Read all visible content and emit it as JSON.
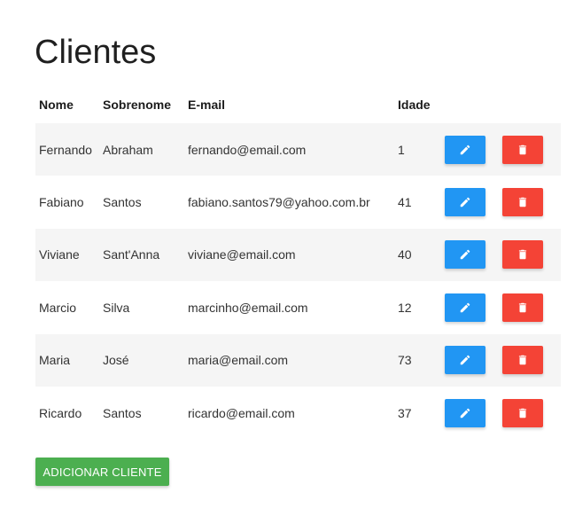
{
  "page": {
    "title": "Clientes"
  },
  "table": {
    "headers": {
      "nome": "Nome",
      "sobrenome": "Sobrenome",
      "email": "E-mail",
      "idade": "Idade"
    },
    "rows": [
      {
        "nome": "Fernando",
        "sobrenome": "Abraham",
        "email": "fernando@email.com",
        "idade": "1"
      },
      {
        "nome": "Fabiano",
        "sobrenome": "Santos",
        "email": "fabiano.santos79@yahoo.com.br",
        "idade": "41"
      },
      {
        "nome": "Viviane",
        "sobrenome": "Sant'Anna",
        "email": "viviane@email.com",
        "idade": "40"
      },
      {
        "nome": "Marcio",
        "sobrenome": "Silva",
        "email": "marcinho@email.com",
        "idade": "12"
      },
      {
        "nome": "Maria",
        "sobrenome": "José",
        "email": "maria@email.com",
        "idade": "73"
      },
      {
        "nome": "Ricardo",
        "sobrenome": "Santos",
        "email": "ricardo@email.com",
        "idade": "37"
      }
    ]
  },
  "actions": {
    "edit_icon": "pencil-icon",
    "delete_icon": "trash-icon",
    "add_label": "ADICIONAR CLIENTE"
  },
  "colors": {
    "edit": "#2196f3",
    "delete": "#f44336",
    "add": "#4caf50",
    "row_stripe": "#f5f5f5"
  }
}
